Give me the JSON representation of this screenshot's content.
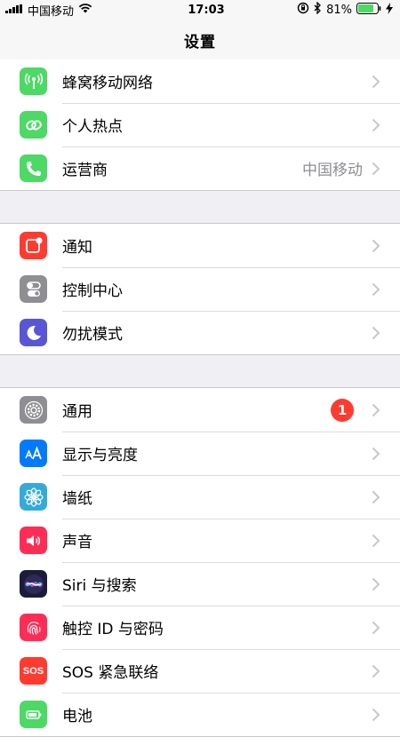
{
  "status_bar": {
    "carrier": "中国移动",
    "time": "17:03",
    "battery_percent": "81%",
    "battery_level": 0.81
  },
  "nav": {
    "title": "设置"
  },
  "groups": [
    {
      "rows": [
        {
          "label": "蜂窝移动网络",
          "icon": "cellular-antenna-icon",
          "color": "#4cd964"
        },
        {
          "label": "个人热点",
          "icon": "hotspot-link-icon",
          "color": "#4cd964"
        },
        {
          "label": "运营商",
          "detail": "中国移动",
          "icon": "phone-icon",
          "color": "#4cd964"
        }
      ]
    },
    {
      "rows": [
        {
          "label": "通知",
          "icon": "notification-icon",
          "color": "#ff3b30"
        },
        {
          "label": "控制中心",
          "icon": "toggle-switches-icon",
          "color": "#8e8e93"
        },
        {
          "label": "勿扰模式",
          "icon": "moon-icon",
          "color": "#5856d6"
        }
      ]
    },
    {
      "rows": [
        {
          "label": "通用",
          "badge": "1",
          "icon": "gear-icon",
          "color": "#8e8e93"
        },
        {
          "label": "显示与亮度",
          "icon": "text-size-icon",
          "color": "#007aff"
        },
        {
          "label": "墙纸",
          "icon": "flower-icon",
          "color": "#34aadc"
        },
        {
          "label": "声音",
          "icon": "speaker-icon",
          "color": "#ff2d55"
        },
        {
          "label": "Siri 与搜索",
          "icon": "siri-icon",
          "color": "#1c1c3a"
        },
        {
          "label": "触控 ID 与密码",
          "icon": "fingerprint-icon",
          "color": "#ff2d55"
        },
        {
          "label": "SOS 紧急联络",
          "icon_text": "SOS",
          "icon": "sos-icon",
          "color": "#ff3b30"
        },
        {
          "label": "电池",
          "icon": "battery-icon",
          "color": "#4cd964"
        }
      ]
    }
  ]
}
